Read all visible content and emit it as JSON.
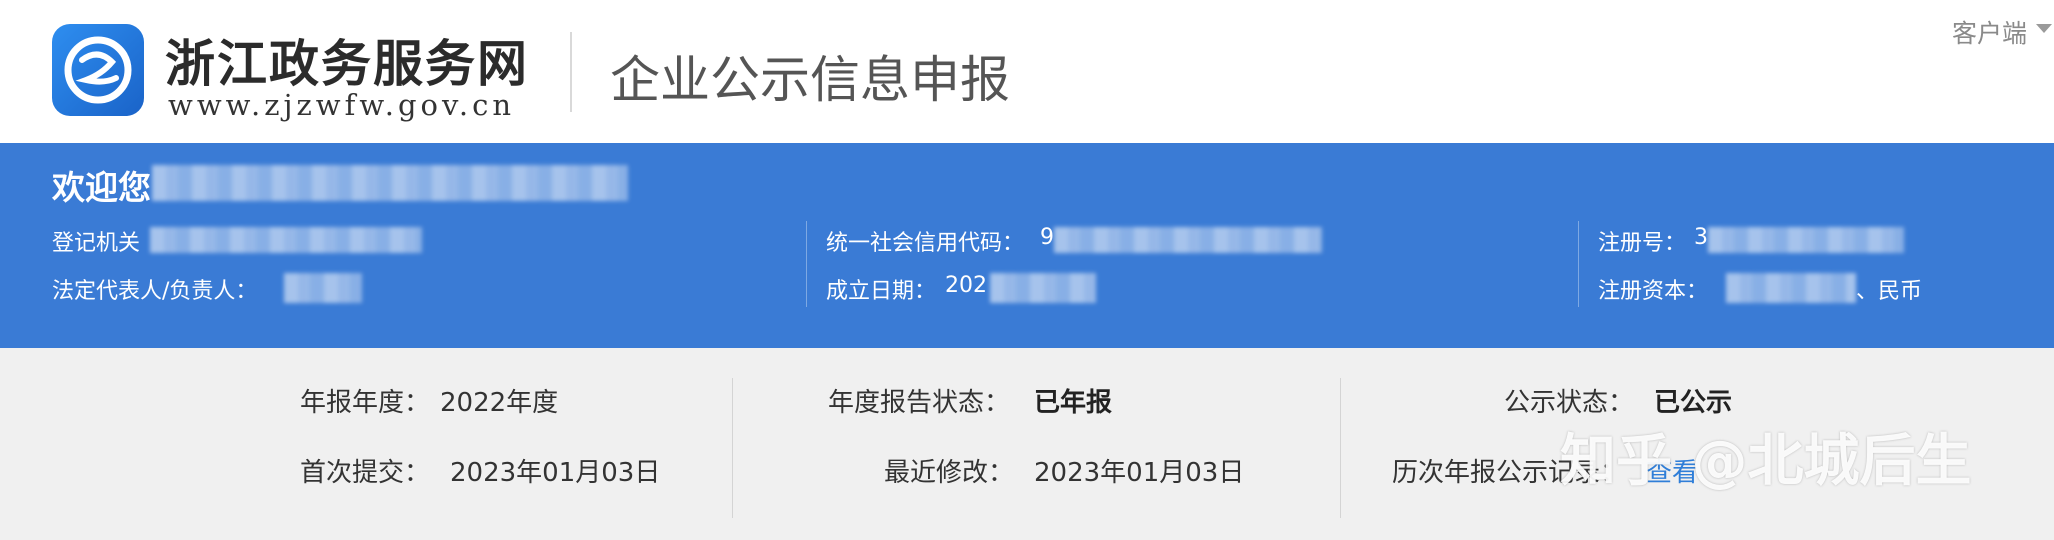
{
  "header": {
    "site_name": "浙江政务服务网",
    "site_url": "www.zjzwfw.gov.cn",
    "page_title": "企业公示信息申报",
    "client_label": "客户端"
  },
  "company": {
    "welcome": "欢迎您",
    "registration_authority_label": "登记机关",
    "credit_code_label": "统一社会信用代码：",
    "credit_code_value": "9",
    "registration_no_label": "注册号：",
    "registration_no_value": "3",
    "legal_rep_label": "法定代表人/负责人：",
    "founded_label": "成立日期：",
    "founded_value": "202",
    "capital_label": "注册资本：",
    "capital_suffix": "、民币"
  },
  "status": {
    "report_year_label": "年报年度：",
    "report_year_value": "2022年度",
    "report_status_label": "年度报告状态：",
    "report_status_value": "已年报",
    "public_status_label": "公示状态：",
    "public_status_value": "已公示",
    "first_submit_label": "首次提交：",
    "first_submit_value": "2023年01月03日",
    "last_modified_label": "最近修改：",
    "last_modified_value": "2023年01月03日",
    "history_label": "历次年报公示记录：",
    "history_link": "查看"
  },
  "watermark": "知乎 @北城后生"
}
